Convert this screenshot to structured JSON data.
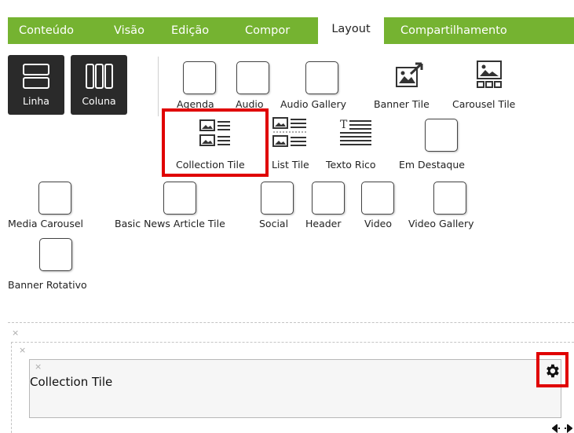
{
  "tabs": [
    {
      "label": "Conteúdo"
    },
    {
      "label": "Visão"
    },
    {
      "label": "Edição"
    },
    {
      "label": "Compor"
    },
    {
      "label": "Layout"
    },
    {
      "label": "Compartilhamento"
    }
  ],
  "layout_buttons": [
    {
      "label": "Linha",
      "icon": "row-layout-icon"
    },
    {
      "label": "Coluna",
      "icon": "column-layout-icon"
    }
  ],
  "tiles": [
    {
      "label": "Agenda"
    },
    {
      "label": "Audio"
    },
    {
      "label": "Audio Gallery"
    },
    {
      "label": "Banner Tile"
    },
    {
      "label": "Carousel Tile"
    },
    {
      "label": "Collection Tile"
    },
    {
      "label": "List Tile"
    },
    {
      "label": "Texto Rico"
    },
    {
      "label": "Em Destaque"
    },
    {
      "label": "Media Carousel"
    },
    {
      "label": "Basic News Article Tile"
    },
    {
      "label": "Social"
    },
    {
      "label": "Header"
    },
    {
      "label": "Video"
    },
    {
      "label": "Video Gallery"
    },
    {
      "label": "Banner Rotativo"
    }
  ],
  "panel": {
    "title": "Collection Tile",
    "close": "×",
    "outer_close": "×",
    "inner_close": "×"
  },
  "colors": {
    "tab_bar": "#75b331",
    "highlight": "#e00000"
  }
}
